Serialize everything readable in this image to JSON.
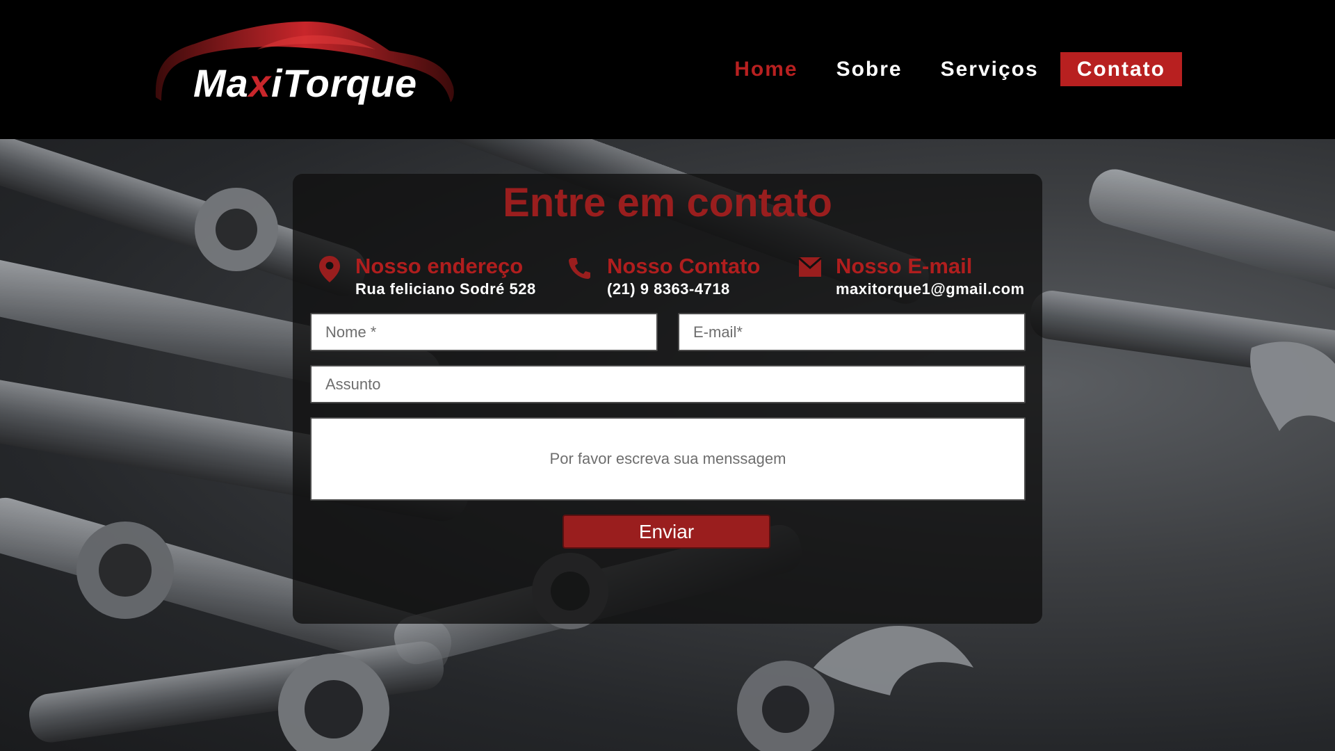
{
  "brand": {
    "name_pre": "Ma",
    "name_x": "x",
    "name_post": "iTorque"
  },
  "nav": {
    "items": [
      {
        "label": "Home",
        "active": true
      },
      {
        "label": "Sobre",
        "active": false
      },
      {
        "label": "Serviços",
        "active": false
      },
      {
        "label": "Contato",
        "active": false
      }
    ]
  },
  "contact": {
    "title": "Entre em contato",
    "address": {
      "title": "Nosso endereço",
      "value": "Rua feliciano Sodré 528",
      "icon": "map-pin-icon"
    },
    "phone": {
      "title": "Nosso Contato",
      "value": "(21) 9 8363-4718",
      "icon": "phone-icon"
    },
    "email": {
      "title": "Nosso E-mail",
      "value": "maxitorque1@gmail.com",
      "icon": "envelope-icon"
    }
  },
  "form": {
    "name_placeholder": "Nome *",
    "email_placeholder": "E-mail*",
    "subject_placeholder": "Assunto",
    "message_placeholder": "Por favor escreva sua menssagem",
    "submit_label": "Enviar"
  },
  "colors": {
    "accent": "#b82020",
    "title_red": "#9a1e1e",
    "header_bg": "#000000"
  }
}
